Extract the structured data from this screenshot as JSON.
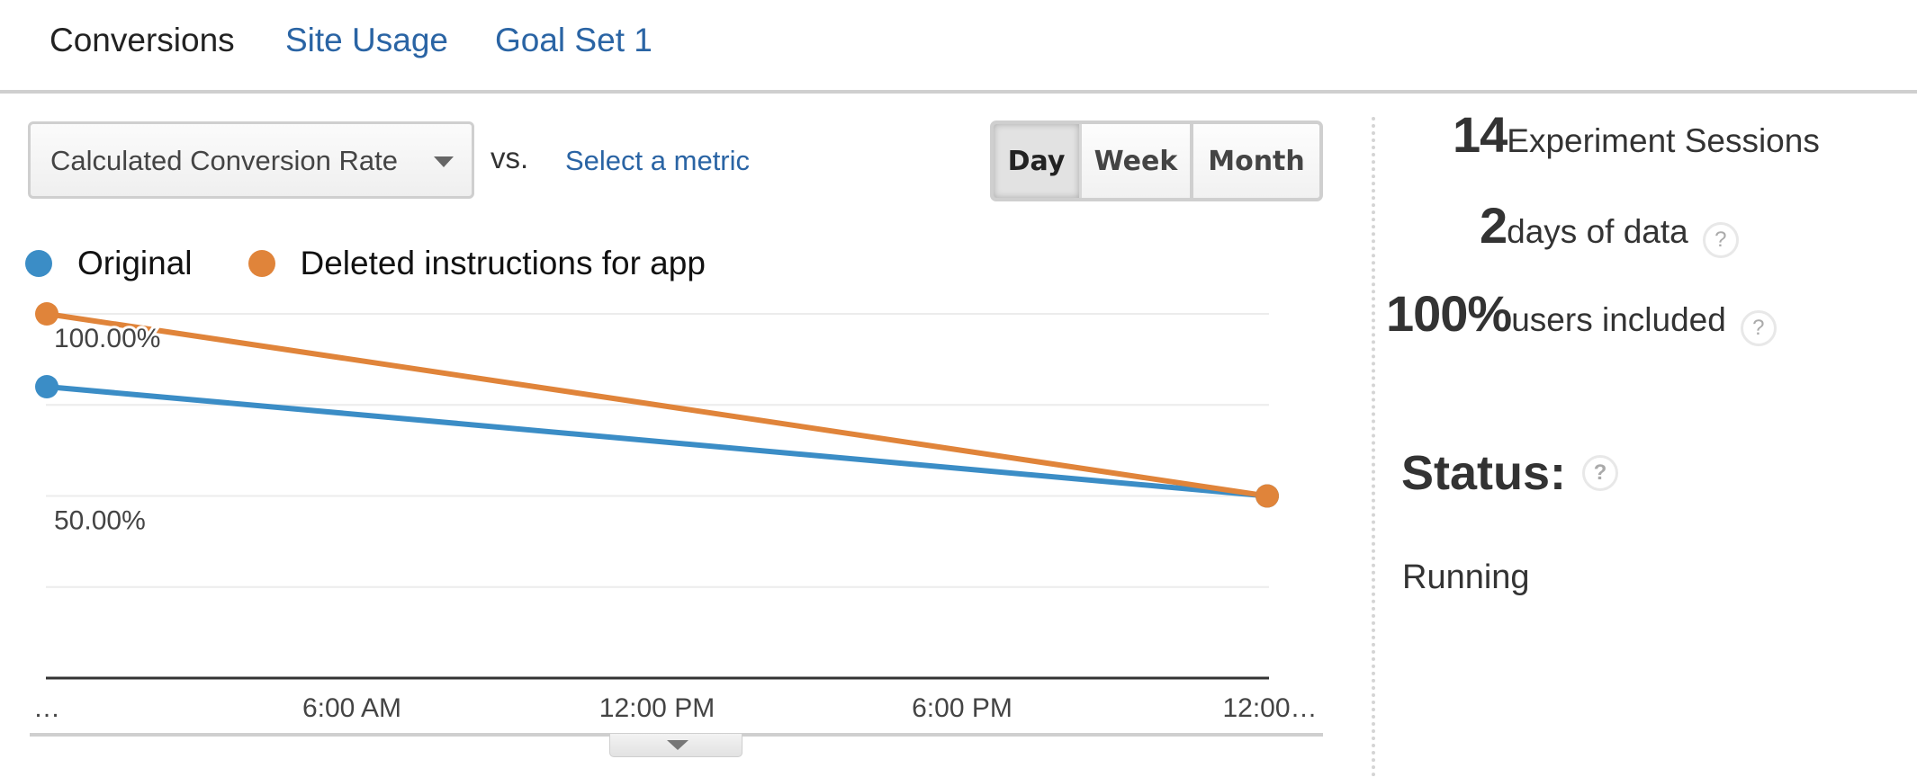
{
  "tabs": [
    {
      "label": "Conversions",
      "active": true
    },
    {
      "label": "Site Usage",
      "active": false
    },
    {
      "label": "Goal Set 1",
      "active": false
    }
  ],
  "controls": {
    "metric_select": {
      "selected": "Calculated Conversion Rate",
      "icon": "caret-down-icon"
    },
    "vs_label": "vs.",
    "secondary_metric_link": "Select a metric",
    "granularity": {
      "options": [
        "Day",
        "Week",
        "Month"
      ],
      "selected": "Day"
    }
  },
  "legend": [
    {
      "label": "Original",
      "color": "#3b8dc6"
    },
    {
      "label": "Deleted instructions for app",
      "color": "#e0843a"
    }
  ],
  "chart_data": {
    "type": "line",
    "title": "",
    "xlabel": "",
    "ylabel": "",
    "x": [
      "12:00 AM (day 1)",
      "12:00 AM (day 2)"
    ],
    "x_tick_labels": [
      "…",
      "6:00 AM",
      "12:00 PM",
      "6:00 PM",
      "12:00…"
    ],
    "y_tick_labels": [
      "100.00%",
      "50.00%"
    ],
    "y_ticks": [
      100,
      50
    ],
    "gridlines_at": [
      100,
      75,
      50,
      25
    ],
    "ylim": [
      0,
      100
    ],
    "grid": true,
    "legend_position": "top-left",
    "series": [
      {
        "name": "Original",
        "color": "#3b8dc6",
        "values": [
          80,
          50
        ]
      },
      {
        "name": "Deleted instructions for app",
        "color": "#e0843a",
        "values": [
          100,
          50
        ]
      }
    ]
  },
  "stats": {
    "sessions": {
      "value": "14",
      "label": "Experiment Sessions"
    },
    "days": {
      "value": "2",
      "label": "days of data",
      "help_icon": "?"
    },
    "users": {
      "value": "100%",
      "label": "users included",
      "help_icon": "?"
    }
  },
  "status": {
    "title": "Status:",
    "help_icon": "?",
    "value": "Running"
  }
}
